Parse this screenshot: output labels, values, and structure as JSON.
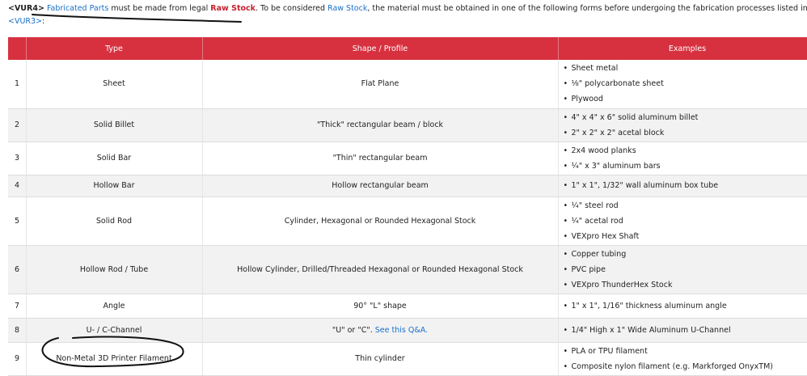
{
  "intro": {
    "tag": "<VUR4>",
    "link1": "Fabricated Parts",
    "t1": " must be made from legal ",
    "raw_bold": "Raw Stock",
    "t2": ". To be considered ",
    "link2": "Raw Stock",
    "t3": ", the material must be obtained in one of the following forms before undergoing the fabrication processes listed in",
    "link3": "<VUR3>",
    "t4": ":"
  },
  "table": {
    "headers": [
      "",
      "Type",
      "Shape / Profile",
      "Examples"
    ],
    "rows": [
      {
        "num": "1",
        "type": "Sheet",
        "shape": "Flat Plane",
        "examples": [
          "Sheet metal",
          "⅛\" polycarbonate sheet",
          "Plywood"
        ]
      },
      {
        "num": "2",
        "type": "Solid Billet",
        "shape": "\"Thick\" rectangular beam / block",
        "examples": [
          "4\" x 4\" x 6\" solid aluminum billet",
          "2\" x 2\" x 2\" acetal block"
        ]
      },
      {
        "num": "3",
        "type": "Solid Bar",
        "shape": "\"Thin\" rectangular beam",
        "examples": [
          "2x4 wood planks",
          "¼\" x 3\" aluminum bars"
        ]
      },
      {
        "num": "4",
        "type": "Hollow Bar",
        "shape": "Hollow rectangular beam",
        "examples": [
          "1\" x 1\", 1/32\" wall aluminum box tube"
        ]
      },
      {
        "num": "5",
        "type": "Solid Rod",
        "shape": "Cylinder, Hexagonal or Rounded Hexagonal Stock",
        "examples": [
          "¼\" steel rod",
          "¼\" acetal rod",
          "VEXpro Hex Shaft"
        ]
      },
      {
        "num": "6",
        "type": "Hollow Rod / Tube",
        "shape": "Hollow Cylinder, Drilled/Threaded Hexagonal or Rounded Hexagonal Stock",
        "examples": [
          "Copper tubing",
          "PVC pipe",
          "VEXpro ThunderHex Stock"
        ]
      },
      {
        "num": "7",
        "type": "Angle",
        "shape": "90° \"L\" shape",
        "examples": [
          "1\" x 1\", 1/16\" thickness aluminum angle"
        ]
      },
      {
        "num": "8",
        "type": "U- / C-Channel",
        "shape": "\"U\" or \"C\". ",
        "shape_link": "See this Q&A.",
        "examples": [
          "1/4\" High x 1\" Wide Aluminum U-Channel"
        ]
      },
      {
        "num": "9",
        "type": "Non-Metal 3D Printer Filament",
        "shape": "Thin cylinder",
        "examples": [
          "PLA or TPU filament",
          "Composite nylon filament (e.g. Markforged OnyxTM)"
        ]
      }
    ]
  }
}
